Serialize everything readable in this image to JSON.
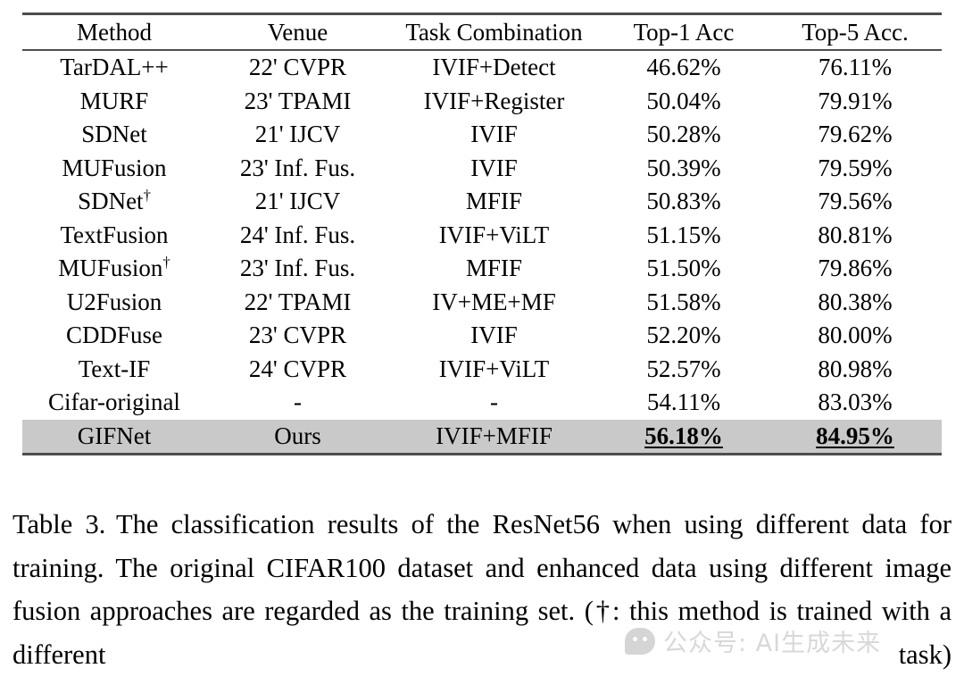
{
  "table": {
    "columns": [
      "Method",
      "Venue",
      "Task Combination",
      "Top-1 Acc",
      "Top-5 Acc."
    ],
    "rows": [
      {
        "method": "TarDAL++",
        "dagger": false,
        "venue": "22' CVPR",
        "task": "IVIF+Detect",
        "top1": "46.62%",
        "top5": "76.11%",
        "highlight": false
      },
      {
        "method": "MURF",
        "dagger": false,
        "venue": "23' TPAMI",
        "task": "IVIF+Register",
        "top1": "50.04%",
        "top5": "79.91%",
        "highlight": false
      },
      {
        "method": "SDNet",
        "dagger": false,
        "venue": "21' IJCV",
        "task": "IVIF",
        "top1": "50.28%",
        "top5": "79.62%",
        "highlight": false
      },
      {
        "method": "MUFusion",
        "dagger": false,
        "venue": "23' Inf. Fus.",
        "task": "IVIF",
        "top1": "50.39%",
        "top5": "79.59%",
        "highlight": false
      },
      {
        "method": "SDNet",
        "dagger": true,
        "venue": "21' IJCV",
        "task": "MFIF",
        "top1": "50.83%",
        "top5": "79.56%",
        "highlight": false
      },
      {
        "method": "TextFusion",
        "dagger": false,
        "venue": "24' Inf. Fus.",
        "task": "IVIF+ViLT",
        "top1": "51.15%",
        "top5": "80.81%",
        "highlight": false
      },
      {
        "method": "MUFusion",
        "dagger": true,
        "venue": "23' Inf. Fus.",
        "task": "MFIF",
        "top1": "51.50%",
        "top5": "79.86%",
        "highlight": false
      },
      {
        "method": "U2Fusion",
        "dagger": false,
        "venue": "22' TPAMI",
        "task": "IV+ME+MF",
        "top1": "51.58%",
        "top5": "80.38%",
        "highlight": false
      },
      {
        "method": "CDDFuse",
        "dagger": false,
        "venue": "23' CVPR",
        "task": "IVIF",
        "top1": "52.20%",
        "top5": "80.00%",
        "highlight": false
      },
      {
        "method": "Text-IF",
        "dagger": false,
        "venue": "24' CVPR",
        "task": "IVIF+ViLT",
        "top1": "52.57%",
        "top5": "80.98%",
        "highlight": false
      },
      {
        "method": "Cifar-original",
        "dagger": false,
        "venue": "-",
        "task": "-",
        "top1": "54.11%",
        "top5": "83.03%",
        "highlight": false
      },
      {
        "method": "GIFNet",
        "dagger": false,
        "venue": "Ours",
        "task": "IVIF+MFIF",
        "top1": "56.18%",
        "top5": "84.95%",
        "highlight": true
      }
    ]
  },
  "caption": {
    "label": "Table 3.",
    "text": "The classification results of the ResNet56 when using different data for training. The original CIFAR100 dataset and enhanced data using different image fusion approaches are regarded as the training set. (†: this method is trained with a different task)"
  },
  "watermark": {
    "text": "公众号: AI生成未来"
  },
  "colors": {
    "highlight_row_bg": "#c9c9c9",
    "rule": "#4d4d4d",
    "watermark_text": "#b9b9b9"
  }
}
